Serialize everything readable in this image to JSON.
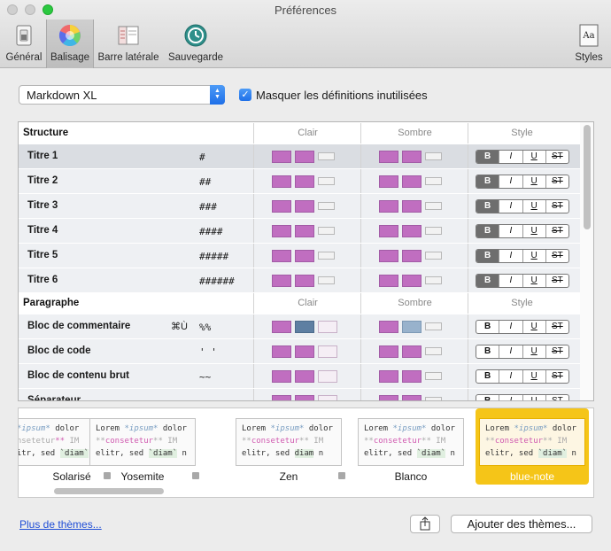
{
  "window": {
    "title": "Préférences"
  },
  "toolbar": {
    "items": [
      {
        "label": "Général"
      },
      {
        "label": "Balisage"
      },
      {
        "label": "Barre latérale"
      },
      {
        "label": "Sauvegarde"
      },
      {
        "label": "Styles"
      }
    ]
  },
  "controls": {
    "syntax_value": "Markdown XL",
    "hide_unused_label": "Masquer les définitions inutilisées"
  },
  "table": {
    "col_light": "Clair",
    "col_dark": "Sombre",
    "col_style": "Style",
    "style_buttons": [
      "B",
      "I",
      "U",
      "ST"
    ],
    "sections": [
      {
        "title": "Structure",
        "rows": [
          {
            "name": "Titre 1",
            "symbol": "#",
            "shortcut": ""
          },
          {
            "name": "Titre 2",
            "symbol": "##",
            "shortcut": ""
          },
          {
            "name": "Titre 3",
            "symbol": "###",
            "shortcut": ""
          },
          {
            "name": "Titre 4",
            "symbol": "####",
            "shortcut": ""
          },
          {
            "name": "Titre 5",
            "symbol": "#####",
            "shortcut": ""
          },
          {
            "name": "Titre 6",
            "symbol": "######",
            "shortcut": ""
          }
        ]
      },
      {
        "title": "Paragraphe",
        "rows": [
          {
            "name": "Bloc de commentaire",
            "symbol": "%%",
            "shortcut": "⌘Ù"
          },
          {
            "name": "Bloc de code",
            "symbol": "' '",
            "shortcut": ""
          },
          {
            "name": "Bloc de contenu brut",
            "symbol": "~~",
            "shortcut": ""
          },
          {
            "name": "Séparateur",
            "symbol": "----",
            "shortcut": ""
          }
        ]
      }
    ]
  },
  "themes": {
    "items": [
      {
        "name": "Solarisé",
        "l1": [
          "e ",
          "*ipsum*",
          " dolor"
        ],
        "l2": [
          "consetetur",
          "** ",
          "IM"
        ],
        "l3": [
          "elitr, sed ",
          "`diam`",
          " n"
        ]
      },
      {
        "name": "Yosemite",
        "l1": [
          "Lorem ",
          "*ipsum*",
          " dolor"
        ],
        "l2": [
          "**",
          "consetetur",
          "**  ",
          "IM"
        ],
        "l3": [
          "elitr, sed ",
          "`diam`",
          " n"
        ]
      },
      {
        "name": "Zen",
        "l1": [
          "Lorem ",
          "*ipsum*",
          " dolor"
        ],
        "l2": [
          "**",
          "consetetur",
          "** ",
          "IM"
        ],
        "l3": [
          "elitr, sed ",
          "diam",
          " n"
        ]
      },
      {
        "name": "Blanco",
        "l1": [
          "Lorem ",
          "*ipsum*",
          " dolor"
        ],
        "l2": [
          "**",
          "consetetur",
          "** ",
          "IM"
        ],
        "l3": [
          "elitr, sed ",
          "`diam`",
          " n"
        ]
      },
      {
        "name": "blue-note",
        "l1": [
          "Lorem ",
          "*ipsum*",
          " dolor"
        ],
        "l2": [
          "**",
          "consetetur",
          "** ",
          "IM"
        ],
        "l3": [
          "elitr, sed ",
          "`diam`",
          " n"
        ]
      }
    ]
  },
  "footer": {
    "more_themes_link": "Plus de thèmes...",
    "add_themes_button": "Ajouter des thèmes..."
  },
  "colors": {
    "accent": "#1e6fe8",
    "selected_theme": "#f5c518",
    "magenta_swatch": "#c06ec0"
  }
}
